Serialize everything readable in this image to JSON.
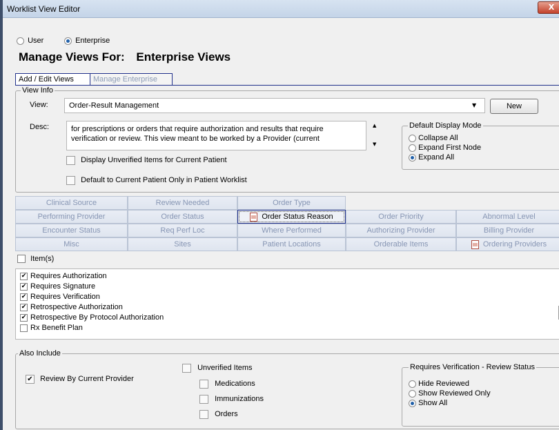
{
  "window": {
    "title": "Worklist View Editor",
    "close_label": "X"
  },
  "scope": {
    "user_label": "User",
    "enterprise_label": "Enterprise",
    "selected": "Enterprise"
  },
  "header": {
    "manage_label": "Manage Views For:",
    "manage_value": "Enterprise Views"
  },
  "tabs": [
    {
      "label": "Add / Edit Views",
      "active": true
    },
    {
      "label": "Manage Enterprise",
      "active": false
    }
  ],
  "view_info": {
    "legend": "View Info",
    "view_label": "View:",
    "view_value": "Order-Result Management",
    "new_button": "New",
    "desc_label": "Desc:",
    "desc_value": "for prescriptions or orders that require authorization and results that require verification or review.  This view meant to be worked by a Provider (current",
    "display_unverified_label": "Display Unverified Items for Current Patient",
    "display_unverified_checked": false,
    "default_current_label": "Default to Current Patient Only in Patient Worklist",
    "default_current_checked": false
  },
  "display_mode": {
    "legend": "Default Display Mode",
    "options": [
      "Collapse All",
      "Expand First Node",
      "Expand All"
    ],
    "selected": "Expand All"
  },
  "criteria_grid": {
    "rows": [
      [
        "Clinical Source",
        "Review Needed",
        "Order Type"
      ],
      [
        "Performing Provider",
        "Order Status",
        "Order Status Reason",
        "Order Priority",
        "Abnormal Level"
      ],
      [
        "Encounter Status",
        "Req Perf Loc",
        "Where Performed",
        "Authorizing Provider",
        "Billing Provider"
      ],
      [
        "Misc",
        "Sites",
        "Patient Locations",
        "Orderable Items",
        "Ordering Providers"
      ]
    ],
    "active": "Order Status Reason",
    "with_icon": [
      "Order Status Reason",
      "Ordering Providers"
    ]
  },
  "items": {
    "header": "Item(s)",
    "header_checked": false,
    "list": [
      {
        "label": "Requires Authorization",
        "checked": true
      },
      {
        "label": "Requires Signature",
        "checked": true
      },
      {
        "label": "Requires Verification",
        "checked": true
      },
      {
        "label": "Retrospective Authorization",
        "checked": true
      },
      {
        "label": "Retrospective By Protocol Authorization",
        "checked": true
      },
      {
        "label": "Rx Benefit Plan",
        "checked": false
      }
    ]
  },
  "also_include": {
    "legend": "Also Include",
    "review_by_current_label": "Review By Current Provider",
    "review_by_current_checked": true,
    "unverified_items_label": "Unverified Items",
    "unverified_items_checked": false,
    "sub_items": [
      {
        "label": "Medications",
        "checked": false
      },
      {
        "label": "Immunizations",
        "checked": false
      },
      {
        "label": "Orders",
        "checked": false
      }
    ]
  },
  "review_status": {
    "legend": "Requires Verification - Review Status",
    "options": [
      "Hide Reviewed",
      "Show Reviewed Only",
      "Show All"
    ],
    "selected": "Show All"
  },
  "icons": {
    "close": "close-icon",
    "dropdown": "chevron-down-icon",
    "doc": "document-icon",
    "check": "checkmark-icon"
  }
}
